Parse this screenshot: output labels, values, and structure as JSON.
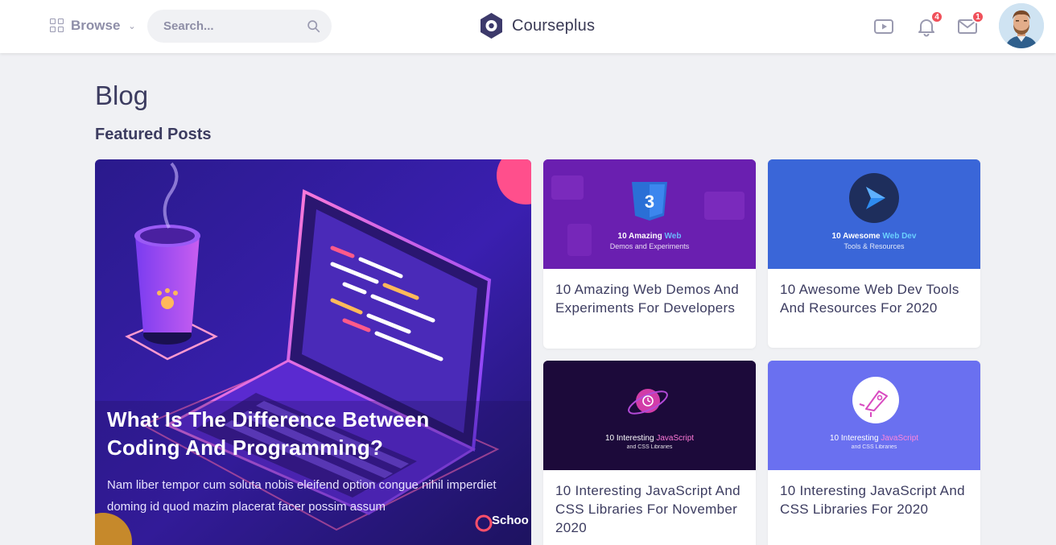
{
  "header": {
    "browse_label": "Browse",
    "search_placeholder": "Search...",
    "logo_text": "Courseplus",
    "notification_count": "4",
    "message_count": "1"
  },
  "page": {
    "title": "Blog",
    "section_title": "Featured Posts"
  },
  "featured": {
    "title": "What Is The Difference Between Coding And Programming?",
    "excerpt": "Nam liber tempor cum soluta nobis eleifend option congue nihil imperdiet doming id quod mazim placerat facer possim assum",
    "brand": "Schoo"
  },
  "cards": [
    {
      "title": "10 Amazing Web Demos And Experiments For Developers",
      "thumb_line1": "10 Amazing",
      "thumb_accent": "Web",
      "thumb_line2": "Demos and Experiments",
      "thumb_color": "#6a1fb0"
    },
    {
      "title": "10 Awesome Web Dev Tools And Resources For 2020",
      "thumb_line1": "10 Awesome",
      "thumb_accent": "Web Dev",
      "thumb_line2": "Tools & Resources",
      "thumb_color": "#3a66d8"
    },
    {
      "title": "10 Interesting JavaScript And CSS Libraries For November 2020",
      "thumb_line1": "10 Interesting",
      "thumb_accent": "JavaScript",
      "thumb_line2": "and CSS Libraries",
      "thumb_color": "#1c0a3a"
    },
    {
      "title": "10 Interesting JavaScript And CSS Libraries For 2020",
      "thumb_line1": "10 Interesting",
      "thumb_accent": "JavaScript",
      "thumb_line2": "and CSS Libraries",
      "thumb_color": "#6a70f0"
    }
  ],
  "colors": {
    "accent": "#3c3c60",
    "badge": "#f0505a",
    "background": "#f0f1f4"
  },
  "icons": {
    "browse": "grid-icon",
    "search": "search-icon",
    "video": "video-icon",
    "notifications": "bell-icon",
    "messages": "mail-icon"
  }
}
